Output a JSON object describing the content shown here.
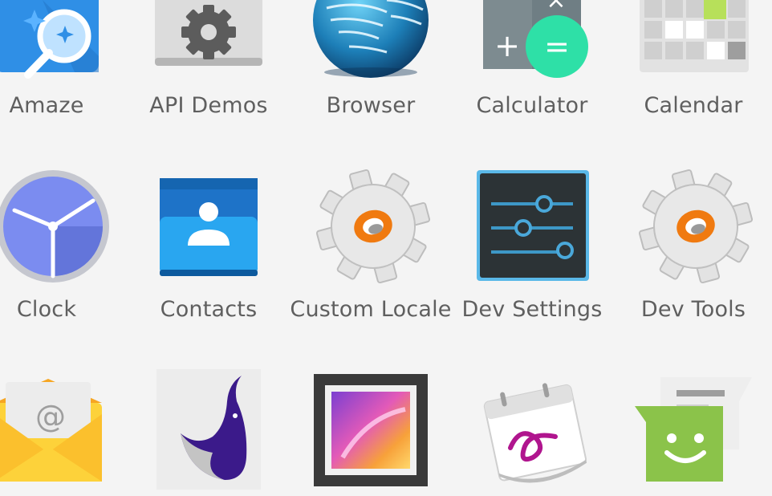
{
  "apps": [
    {
      "name": "Amaze",
      "icon": "magnifier-icon"
    },
    {
      "name": "API Demos",
      "icon": "folder-gear-icon"
    },
    {
      "name": "Browser",
      "icon": "globe-icon"
    },
    {
      "name": "Calculator",
      "icon": "calculator-icon"
    },
    {
      "name": "Calendar",
      "icon": "calendar-grid-icon"
    },
    {
      "name": "Clock",
      "icon": "clock-icon"
    },
    {
      "name": "Contacts",
      "icon": "contact-card-icon"
    },
    {
      "name": "Custom Locale",
      "icon": "gear-icon"
    },
    {
      "name": "Dev Settings",
      "icon": "sliders-icon"
    },
    {
      "name": "Dev Tools",
      "icon": "gear-icon"
    },
    {
      "name": "",
      "icon": "email-envelope-icon"
    },
    {
      "name": "",
      "icon": "whale-icon"
    },
    {
      "name": "",
      "icon": "gallery-picture-icon"
    },
    {
      "name": "",
      "icon": "signature-calendar-icon"
    },
    {
      "name": "",
      "icon": "messaging-smiley-icon"
    }
  ],
  "calculator_symbols": {
    "plus": "+",
    "equals": "=",
    "times": "×"
  },
  "email_symbol": "@",
  "colors": {
    "background": "#f4f4f4",
    "label": "#5f5f5f",
    "amaze_blue": "#2f8fe6",
    "clock_face": "#7b8cf0",
    "contacts_blue": "#1e8fe0",
    "calc_accent": "#2ee0a7",
    "dev_settings_dark": "#2c3336",
    "messaging_green": "#8bc34a",
    "email_yellow": "#fdd23a"
  }
}
